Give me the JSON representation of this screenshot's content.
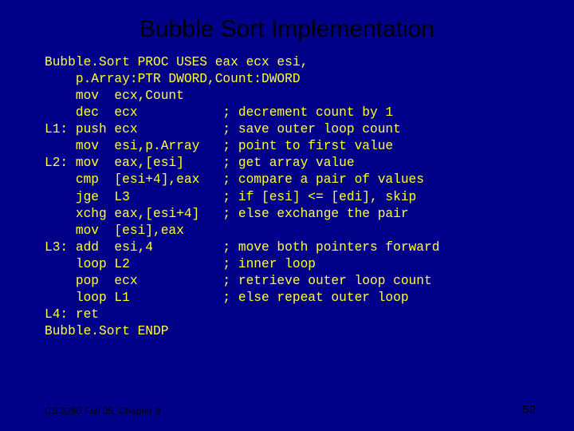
{
  "title": "Bubble Sort Implementation",
  "code": {
    "l0": "Bubble.Sort PROC USES eax ecx esi,",
    "l1": "    p.Array:PTR DWORD,Count:DWORD",
    "l2": "    mov  ecx,Count",
    "l3": "    dec  ecx           ; decrement count by 1",
    "l4": "L1: push ecx           ; save outer loop count",
    "l5": "    mov  esi,p.Array   ; point to first value",
    "l6": "L2: mov  eax,[esi]     ; get array value",
    "l7": "    cmp  [esi+4],eax   ; compare a pair of values",
    "l8": "    jge  L3            ; if [esi] <= [edi], skip",
    "l9": "    xchg eax,[esi+4]   ; else exchange the pair",
    "l10": "    mov  [esi],eax",
    "l11": "L3: add  esi,4         ; move both pointers forward",
    "l12": "    loop L2            ; inner loop",
    "l13": "    pop  ecx           ; retrieve outer loop count",
    "l14": "    loop L1            ; else repeat outer loop",
    "l15": "L4: ret",
    "l16": "Bubble.Sort ENDP"
  },
  "footer": {
    "left": "CS 3280 Fall 05, Chapter 9",
    "right": "52"
  }
}
